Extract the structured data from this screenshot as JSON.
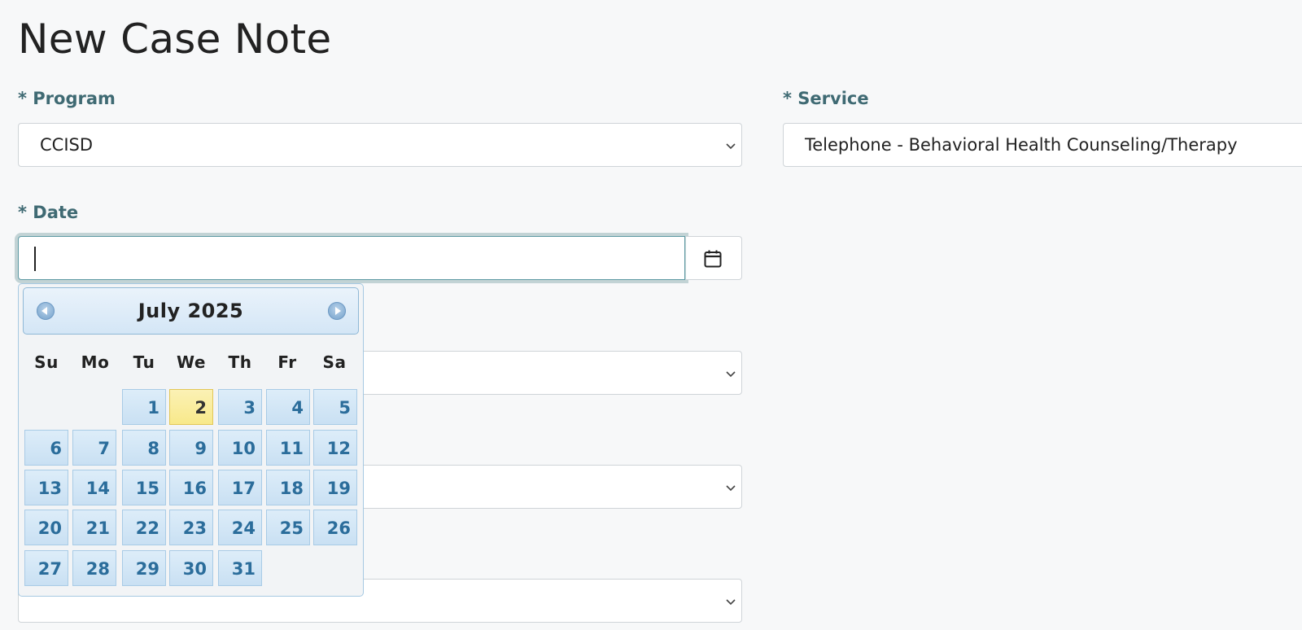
{
  "page": {
    "title": "New Case Note"
  },
  "program": {
    "label": "* Program",
    "value": "CCISD"
  },
  "service": {
    "label": "* Service",
    "value": "Telephone - Behavioral Health Counseling/Therapy"
  },
  "date": {
    "label": "* Date",
    "value": "",
    "calendar_icon": "calendar-icon"
  },
  "datepicker": {
    "month_year": "July 2025",
    "prev_icon": "prev-month-icon",
    "next_icon": "next-month-icon",
    "weekdays": [
      "Su",
      "Mo",
      "Tu",
      "We",
      "Th",
      "Fr",
      "Sa"
    ],
    "first_weekday_index": 2,
    "days_in_month": 31,
    "days": [
      "1",
      "2",
      "3",
      "4",
      "5",
      "6",
      "7",
      "8",
      "9",
      "10",
      "11",
      "12",
      "13",
      "14",
      "15",
      "16",
      "17",
      "18",
      "19",
      "20",
      "21",
      "22",
      "23",
      "24",
      "25",
      "26",
      "27",
      "28",
      "29",
      "30",
      "31"
    ],
    "highlighted_day": "2",
    "colors": {
      "day_text": "#2b6d9b",
      "today_bg": "#f8e98a",
      "day_bg": "#c9e0f3"
    }
  },
  "colors": {
    "label": "#3f6a73",
    "focus_border": "#5e9aa4"
  }
}
